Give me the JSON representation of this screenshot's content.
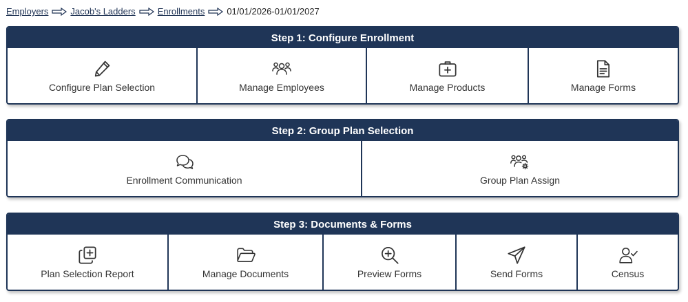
{
  "breadcrumb": {
    "items": [
      "Employers",
      "Jacob's Ladders",
      "Enrollments"
    ],
    "current": "01/01/2026-01/01/2027"
  },
  "step1": {
    "title": "Step 1: Configure Enrollment",
    "tiles": [
      {
        "label": "Configure Plan Selection",
        "icon": "pencil-icon"
      },
      {
        "label": "Manage Employees",
        "icon": "users-icon"
      },
      {
        "label": "Manage Products",
        "icon": "medical-kit-icon"
      },
      {
        "label": "Manage Forms",
        "icon": "document-icon"
      }
    ]
  },
  "step2": {
    "title": "Step 2: Group Plan Selection",
    "tiles": [
      {
        "label": "Enrollment Communication",
        "icon": "chat-bubbles-icon"
      },
      {
        "label": "Group Plan Assign",
        "icon": "users-gear-icon"
      }
    ]
  },
  "step3": {
    "title": "Step 3: Documents & Forms",
    "tiles": [
      {
        "label": "Plan Selection Report",
        "icon": "copy-plus-icon"
      },
      {
        "label": "Manage Documents",
        "icon": "folder-open-icon"
      },
      {
        "label": "Preview Forms",
        "icon": "zoom-in-icon"
      },
      {
        "label": "Send Forms",
        "icon": "paper-plane-icon"
      },
      {
        "label": "Census",
        "icon": "user-check-icon"
      }
    ]
  },
  "colors": {
    "header_bg": "#1f3557",
    "link": "#1c3052"
  }
}
